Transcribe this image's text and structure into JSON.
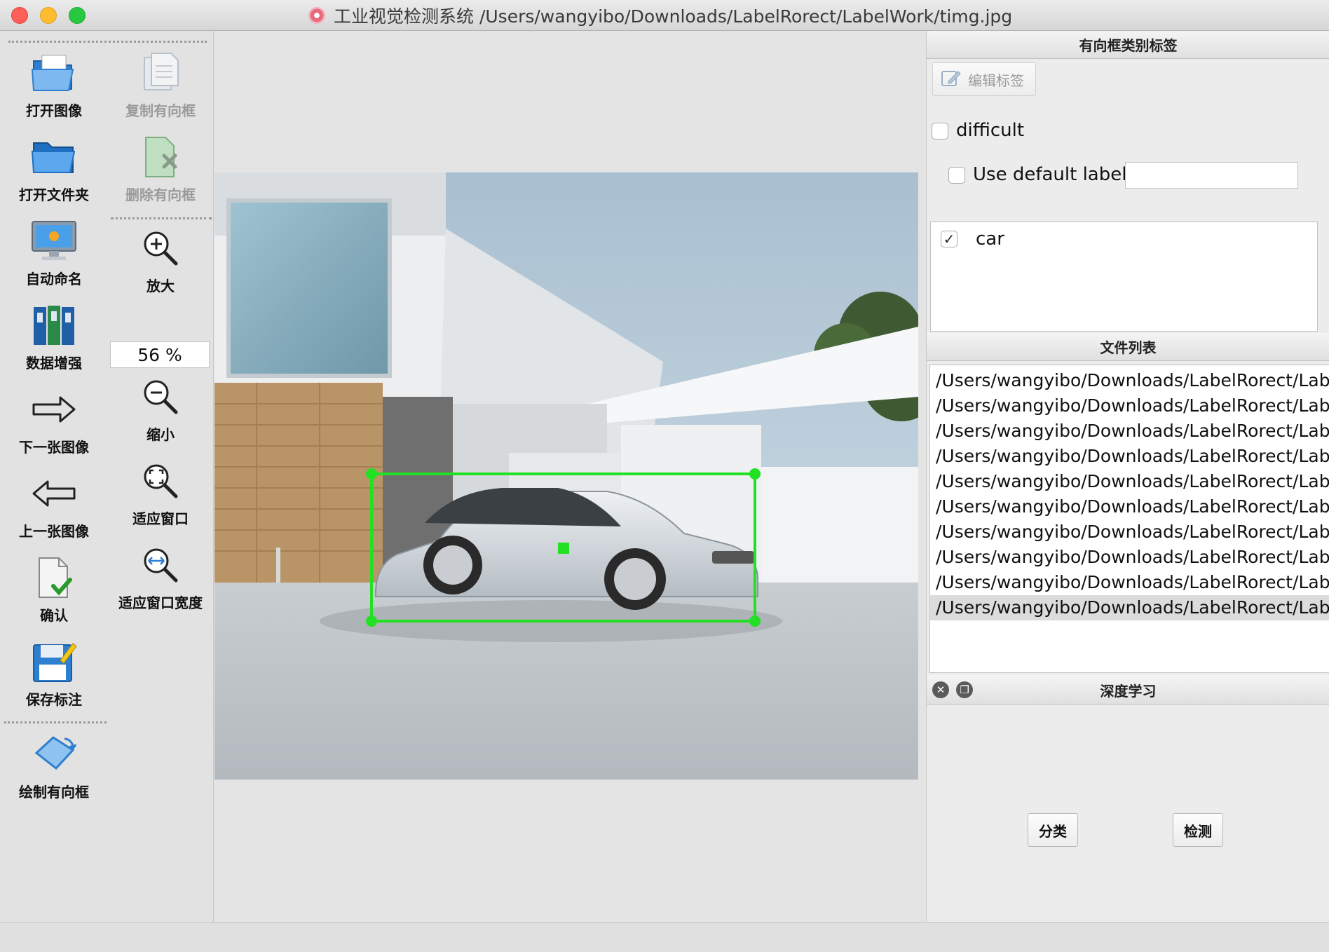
{
  "window": {
    "title": "工业视觉检测系统 /Users/wangyibo/Downloads/LabelRorect/LabelWork/timg.jpg"
  },
  "toolbar": {
    "open_image": "打开图像",
    "copy_box": "复制有向框",
    "open_folder": "打开文件夹",
    "delete_box": "删除有向框",
    "auto_name": "自动命名",
    "zoom_in": "放大",
    "zoom_value": "56 %",
    "data_augment": "数据增强",
    "zoom_out": "缩小",
    "next_image": "下一张图像",
    "fit_window": "适应窗口",
    "prev_image": "上一张图像",
    "fit_width": "适应窗口宽度",
    "verify": "确认",
    "save_label": "保存标注",
    "draw_box": "绘制有向框",
    "extension": "»"
  },
  "label_panel": {
    "title": "有向框类别标签",
    "edit_label": "编辑标签",
    "difficult": "difficult",
    "use_default_label": "Use default label",
    "default_label_value": "",
    "labels": [
      {
        "name": "car",
        "checked": true
      }
    ]
  },
  "file_panel": {
    "title": "文件列表",
    "files": [
      "/Users/wangyibo/Downloads/LabelRorect/Labe",
      "/Users/wangyibo/Downloads/LabelRorect/Labe",
      "/Users/wangyibo/Downloads/LabelRorect/Labe",
      "/Users/wangyibo/Downloads/LabelRorect/Labe",
      "/Users/wangyibo/Downloads/LabelRorect/Labe",
      "/Users/wangyibo/Downloads/LabelRorect/Labe",
      "/Users/wangyibo/Downloads/LabelRorect/Labe",
      "/Users/wangyibo/Downloads/LabelRorect/Labe",
      "/Users/wangyibo/Downloads/LabelRorect/Labe",
      "/Users/wangyibo/Downloads/LabelRorect/Labe"
    ],
    "selected_index": 9
  },
  "deep_learning": {
    "title": "深度学习",
    "classify": "分类",
    "detect": "检测"
  },
  "colors": {
    "box_green": "#22e022",
    "accent_gray": "#e2e2e2"
  }
}
